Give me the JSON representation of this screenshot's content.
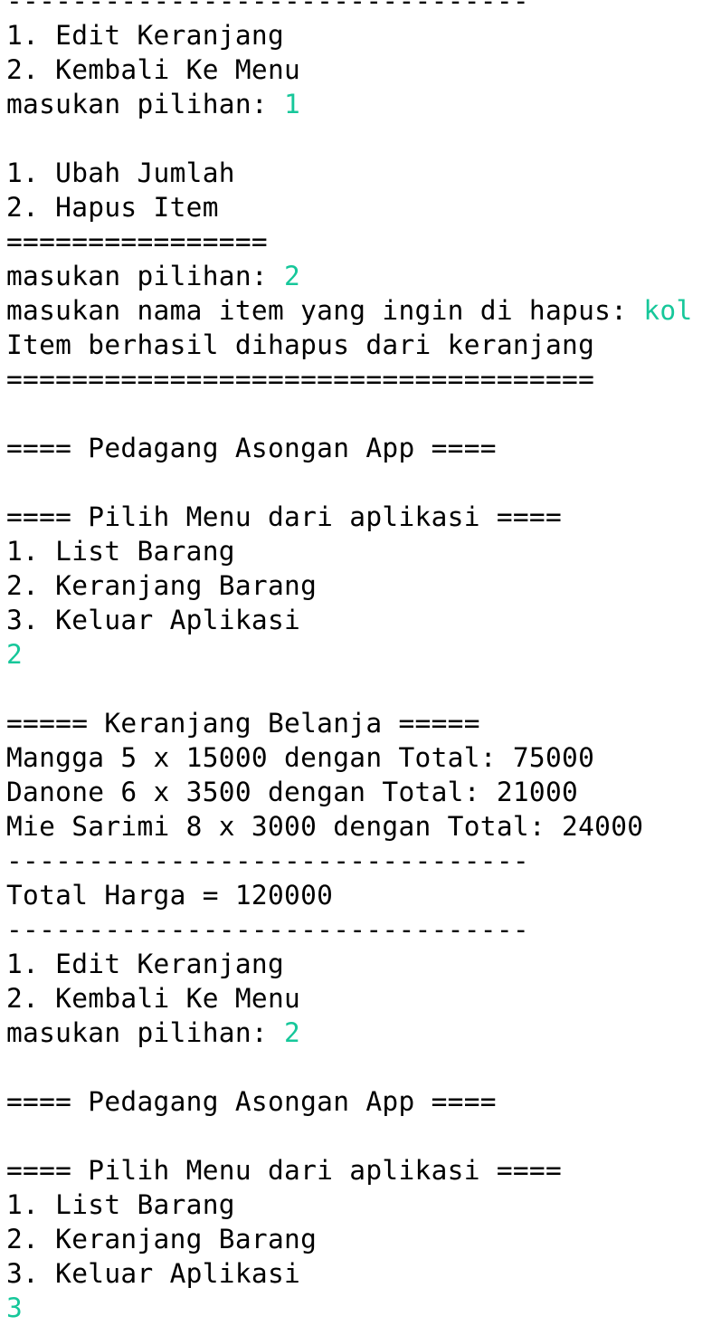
{
  "console": {
    "input_color": "#16c79a",
    "lines": [
      {
        "text": "--------------------------------",
        "input": ""
      },
      {
        "text": "1. Edit Keranjang",
        "input": ""
      },
      {
        "text": "2. Kembali Ke Menu",
        "input": ""
      },
      {
        "text": "masukan pilihan: ",
        "input": "1"
      },
      {
        "text": "",
        "input": ""
      },
      {
        "text": "1. Ubah Jumlah",
        "input": ""
      },
      {
        "text": "2. Hapus Item",
        "input": ""
      },
      {
        "text": "================",
        "input": ""
      },
      {
        "text": "masukan pilihan: ",
        "input": "2"
      },
      {
        "text": "masukan nama item yang ingin di hapus: ",
        "input": "kol"
      },
      {
        "text": "Item berhasil dihapus dari keranjang",
        "input": ""
      },
      {
        "text": "====================================",
        "input": ""
      },
      {
        "text": "",
        "input": ""
      },
      {
        "text": "==== Pedagang Asongan App ====",
        "input": ""
      },
      {
        "text": "",
        "input": ""
      },
      {
        "text": "==== Pilih Menu dari aplikasi ====",
        "input": ""
      },
      {
        "text": "1. List Barang",
        "input": ""
      },
      {
        "text": "2. Keranjang Barang",
        "input": ""
      },
      {
        "text": "3. Keluar Aplikasi",
        "input": ""
      },
      {
        "text": "",
        "input": "2"
      },
      {
        "text": "",
        "input": ""
      },
      {
        "text": "===== Keranjang Belanja =====",
        "input": ""
      },
      {
        "text": "Mangga 5 x 15000 dengan Total: 75000",
        "input": ""
      },
      {
        "text": "Danone 6 x 3500 dengan Total: 21000",
        "input": ""
      },
      {
        "text": "Mie Sarimi 8 x 3000 dengan Total: 24000",
        "input": ""
      },
      {
        "text": "--------------------------------",
        "input": ""
      },
      {
        "text": "Total Harga = 120000",
        "input": ""
      },
      {
        "text": "--------------------------------",
        "input": ""
      },
      {
        "text": "1. Edit Keranjang",
        "input": ""
      },
      {
        "text": "2. Kembali Ke Menu",
        "input": ""
      },
      {
        "text": "masukan pilihan: ",
        "input": "2"
      },
      {
        "text": "",
        "input": ""
      },
      {
        "text": "==== Pedagang Asongan App ====",
        "input": ""
      },
      {
        "text": "",
        "input": ""
      },
      {
        "text": "==== Pilih Menu dari aplikasi ====",
        "input": ""
      },
      {
        "text": "1. List Barang",
        "input": ""
      },
      {
        "text": "2. Keranjang Barang",
        "input": ""
      },
      {
        "text": "3. Keluar Aplikasi",
        "input": ""
      },
      {
        "text": "",
        "input": "3"
      }
    ]
  }
}
